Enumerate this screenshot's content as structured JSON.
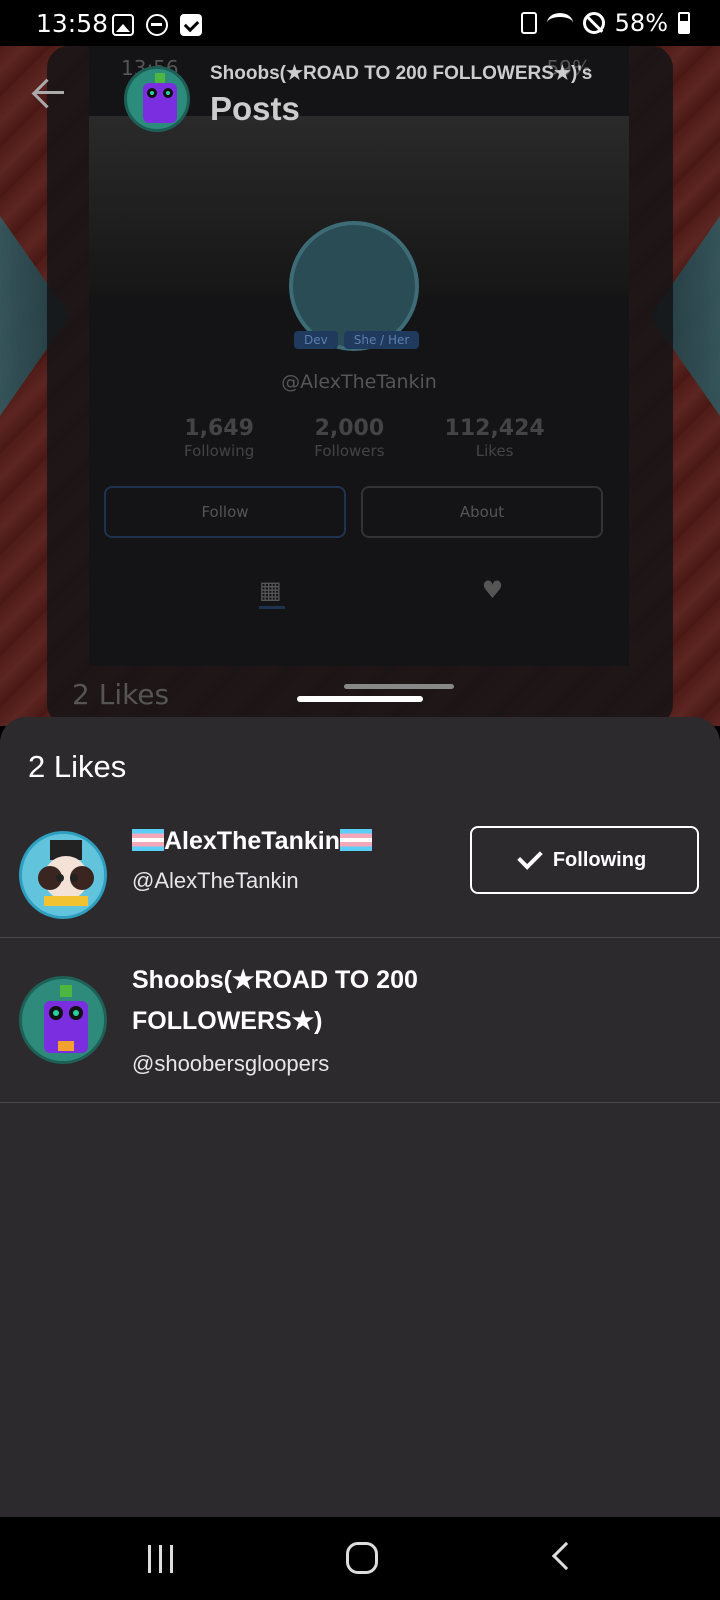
{
  "status_bar": {
    "time": "13:58",
    "battery": "58%"
  },
  "background_post": {
    "header_subtitle": "Shoobs(★ROAD TO 200 FOLLOWERS★)'s",
    "header_title": "Posts",
    "preview": {
      "time": "13:56",
      "battery": "59%",
      "handle": "@AlexTheTankin",
      "badges": [
        "Dev",
        "She / Her"
      ],
      "stats": [
        {
          "value": "1,649",
          "label": "Following"
        },
        {
          "value": "2,000",
          "label": "Followers"
        },
        {
          "value": "112,424",
          "label": "Likes"
        }
      ],
      "follow_label": "Follow",
      "about_label": "About",
      "likes_peek": "2 Likes"
    }
  },
  "likes_sheet": {
    "title": "2 Likes",
    "users": [
      {
        "name": "AlexTheTankin",
        "handle": "@AlexTheTankin",
        "follow_label": "Following",
        "follow_icon": "check-icon"
      },
      {
        "name": "Shoobs(★ROAD TO 200 FOLLOWERS★)",
        "handle": "@shoobersgloopers"
      }
    ]
  },
  "colors": {
    "sheet_bg": "#2c2a2d",
    "accent_teal": "#2e8a7b",
    "trans_blue": "#5bcefa",
    "trans_pink": "#f5a9b8"
  }
}
